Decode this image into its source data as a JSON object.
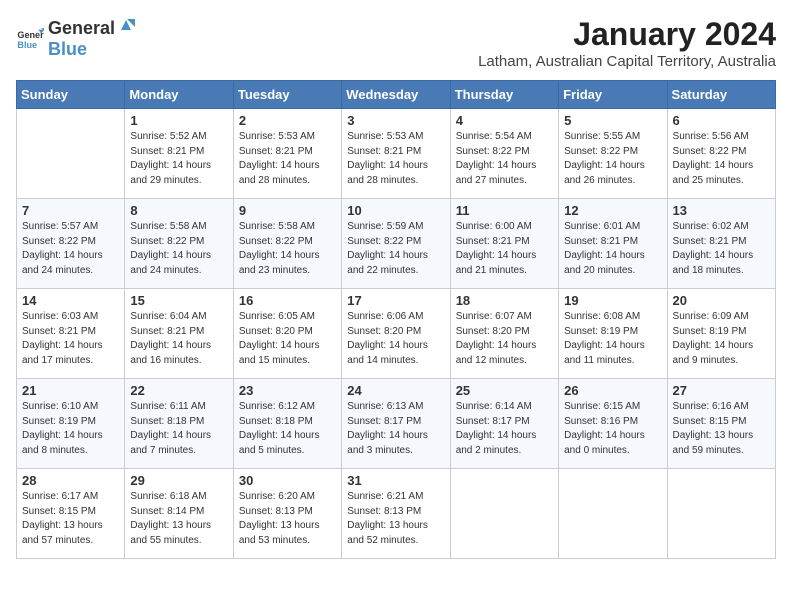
{
  "logo": {
    "general": "General",
    "blue": "Blue"
  },
  "title": "January 2024",
  "location": "Latham, Australian Capital Territory, Australia",
  "days_header": [
    "Sunday",
    "Monday",
    "Tuesday",
    "Wednesday",
    "Thursday",
    "Friday",
    "Saturday"
  ],
  "weeks": [
    [
      {
        "day": "",
        "info": ""
      },
      {
        "day": "1",
        "info": "Sunrise: 5:52 AM\nSunset: 8:21 PM\nDaylight: 14 hours\nand 29 minutes."
      },
      {
        "day": "2",
        "info": "Sunrise: 5:53 AM\nSunset: 8:21 PM\nDaylight: 14 hours\nand 28 minutes."
      },
      {
        "day": "3",
        "info": "Sunrise: 5:53 AM\nSunset: 8:21 PM\nDaylight: 14 hours\nand 28 minutes."
      },
      {
        "day": "4",
        "info": "Sunrise: 5:54 AM\nSunset: 8:22 PM\nDaylight: 14 hours\nand 27 minutes."
      },
      {
        "day": "5",
        "info": "Sunrise: 5:55 AM\nSunset: 8:22 PM\nDaylight: 14 hours\nand 26 minutes."
      },
      {
        "day": "6",
        "info": "Sunrise: 5:56 AM\nSunset: 8:22 PM\nDaylight: 14 hours\nand 25 minutes."
      }
    ],
    [
      {
        "day": "7",
        "info": "Sunrise: 5:57 AM\nSunset: 8:22 PM\nDaylight: 14 hours\nand 24 minutes."
      },
      {
        "day": "8",
        "info": "Sunrise: 5:58 AM\nSunset: 8:22 PM\nDaylight: 14 hours\nand 24 minutes."
      },
      {
        "day": "9",
        "info": "Sunrise: 5:58 AM\nSunset: 8:22 PM\nDaylight: 14 hours\nand 23 minutes."
      },
      {
        "day": "10",
        "info": "Sunrise: 5:59 AM\nSunset: 8:22 PM\nDaylight: 14 hours\nand 22 minutes."
      },
      {
        "day": "11",
        "info": "Sunrise: 6:00 AM\nSunset: 8:21 PM\nDaylight: 14 hours\nand 21 minutes."
      },
      {
        "day": "12",
        "info": "Sunrise: 6:01 AM\nSunset: 8:21 PM\nDaylight: 14 hours\nand 20 minutes."
      },
      {
        "day": "13",
        "info": "Sunrise: 6:02 AM\nSunset: 8:21 PM\nDaylight: 14 hours\nand 18 minutes."
      }
    ],
    [
      {
        "day": "14",
        "info": "Sunrise: 6:03 AM\nSunset: 8:21 PM\nDaylight: 14 hours\nand 17 minutes."
      },
      {
        "day": "15",
        "info": "Sunrise: 6:04 AM\nSunset: 8:21 PM\nDaylight: 14 hours\nand 16 minutes."
      },
      {
        "day": "16",
        "info": "Sunrise: 6:05 AM\nSunset: 8:20 PM\nDaylight: 14 hours\nand 15 minutes."
      },
      {
        "day": "17",
        "info": "Sunrise: 6:06 AM\nSunset: 8:20 PM\nDaylight: 14 hours\nand 14 minutes."
      },
      {
        "day": "18",
        "info": "Sunrise: 6:07 AM\nSunset: 8:20 PM\nDaylight: 14 hours\nand 12 minutes."
      },
      {
        "day": "19",
        "info": "Sunrise: 6:08 AM\nSunset: 8:19 PM\nDaylight: 14 hours\nand 11 minutes."
      },
      {
        "day": "20",
        "info": "Sunrise: 6:09 AM\nSunset: 8:19 PM\nDaylight: 14 hours\nand 9 minutes."
      }
    ],
    [
      {
        "day": "21",
        "info": "Sunrise: 6:10 AM\nSunset: 8:19 PM\nDaylight: 14 hours\nand 8 minutes."
      },
      {
        "day": "22",
        "info": "Sunrise: 6:11 AM\nSunset: 8:18 PM\nDaylight: 14 hours\nand 7 minutes."
      },
      {
        "day": "23",
        "info": "Sunrise: 6:12 AM\nSunset: 8:18 PM\nDaylight: 14 hours\nand 5 minutes."
      },
      {
        "day": "24",
        "info": "Sunrise: 6:13 AM\nSunset: 8:17 PM\nDaylight: 14 hours\nand 3 minutes."
      },
      {
        "day": "25",
        "info": "Sunrise: 6:14 AM\nSunset: 8:17 PM\nDaylight: 14 hours\nand 2 minutes."
      },
      {
        "day": "26",
        "info": "Sunrise: 6:15 AM\nSunset: 8:16 PM\nDaylight: 14 hours\nand 0 minutes."
      },
      {
        "day": "27",
        "info": "Sunrise: 6:16 AM\nSunset: 8:15 PM\nDaylight: 13 hours\nand 59 minutes."
      }
    ],
    [
      {
        "day": "28",
        "info": "Sunrise: 6:17 AM\nSunset: 8:15 PM\nDaylight: 13 hours\nand 57 minutes."
      },
      {
        "day": "29",
        "info": "Sunrise: 6:18 AM\nSunset: 8:14 PM\nDaylight: 13 hours\nand 55 minutes."
      },
      {
        "day": "30",
        "info": "Sunrise: 6:20 AM\nSunset: 8:13 PM\nDaylight: 13 hours\nand 53 minutes."
      },
      {
        "day": "31",
        "info": "Sunrise: 6:21 AM\nSunset: 8:13 PM\nDaylight: 13 hours\nand 52 minutes."
      },
      {
        "day": "",
        "info": ""
      },
      {
        "day": "",
        "info": ""
      },
      {
        "day": "",
        "info": ""
      }
    ]
  ]
}
